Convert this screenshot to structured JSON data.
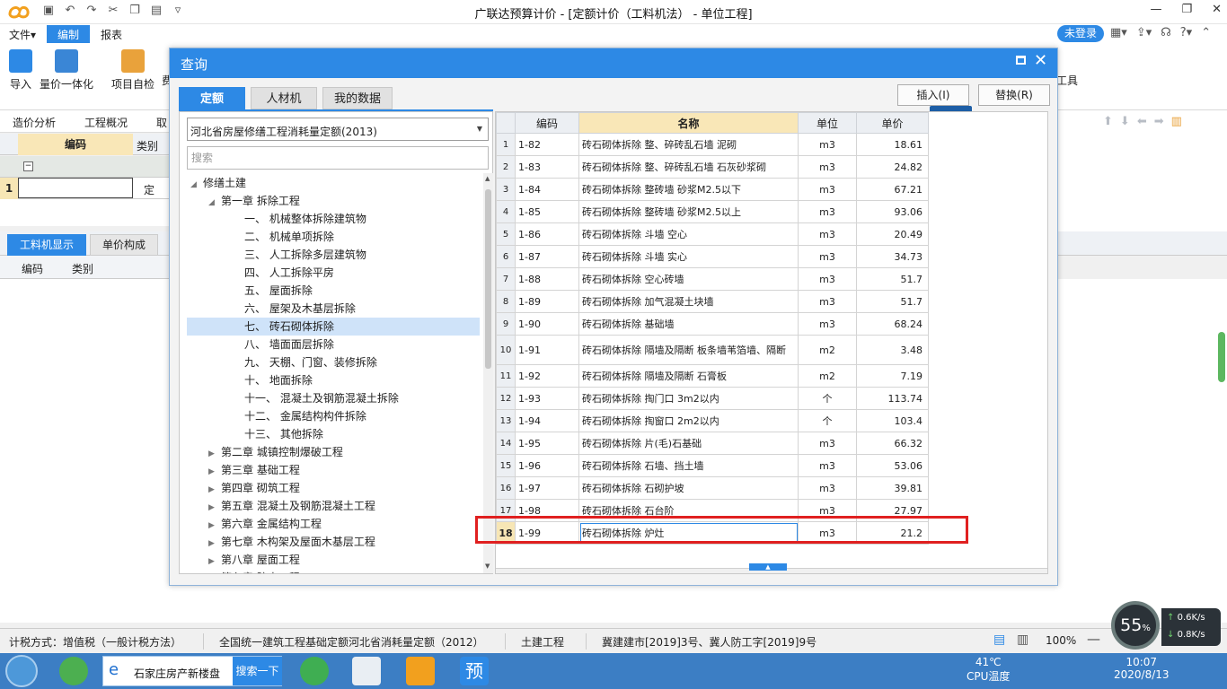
{
  "app": {
    "window_title": "广联达预算计价 - [定额计价（工料机法） - 单位工程]"
  },
  "menu": {
    "file": "文件▾",
    "edit": "编制",
    "report": "报表",
    "login": "未登录"
  },
  "ribbon": {
    "import": "导入",
    "quantity": "量价一体化",
    "check": "项目自检",
    "more": "费",
    "tools": "工具"
  },
  "workspace": {
    "tab_cost_analysis": "造价分析",
    "tab_overview": "工程概况",
    "tab_partial": "取",
    "col_code": "编码",
    "col_type": "类别",
    "row1_num": "1",
    "row1_type": "定",
    "lower_tab_labor": "工料机显示",
    "lower_tab_price": "单价构成",
    "lower_col_code": "编码",
    "lower_col_type": "类别"
  },
  "dialog": {
    "title": "查询",
    "tabs": [
      "定额",
      "人材机",
      "我的数据"
    ],
    "insert_button": "插入(I)",
    "replace_button": "替换(R)",
    "library_selected": "河北省房屋修缮工程消耗量定额(2013)",
    "search_placeholder": "搜索",
    "tree": [
      {
        "label": "修缮土建",
        "level": 0,
        "expander": "▲"
      },
      {
        "label": "第一章  拆除工程",
        "level": 1,
        "expander": "◢"
      },
      {
        "label": "一、  机械整体拆除建筑物",
        "level": 2
      },
      {
        "label": "二、  机械单项拆除",
        "level": 2
      },
      {
        "label": "三、  人工拆除多层建筑物",
        "level": 2
      },
      {
        "label": "四、  人工拆除平房",
        "level": 2
      },
      {
        "label": "五、  屋面拆除",
        "level": 2
      },
      {
        "label": "六、  屋架及木基层拆除",
        "level": 2
      },
      {
        "label": "七、  砖石砌体拆除",
        "level": 2,
        "selected": true
      },
      {
        "label": "八、  墙面面层拆除",
        "level": 2
      },
      {
        "label": "九、  天棚、门窗、装修拆除",
        "level": 2
      },
      {
        "label": "十、  地面拆除",
        "level": 2
      },
      {
        "label": "十一、  混凝土及钢筋混凝土拆除",
        "level": 2
      },
      {
        "label": "十二、  金属结构构件拆除",
        "level": 2
      },
      {
        "label": "十三、  其他拆除",
        "level": 2
      },
      {
        "label": "第二章  城镇控制爆破工程",
        "level": 1,
        "expander": "▶"
      },
      {
        "label": "第三章  基础工程",
        "level": 1,
        "expander": "▶"
      },
      {
        "label": "第四章  砌筑工程",
        "level": 1,
        "expander": "▶"
      },
      {
        "label": "第五章  混凝土及钢筋混凝土工程",
        "level": 1,
        "expander": "▶"
      },
      {
        "label": "第六章  金属结构工程",
        "level": 1,
        "expander": "▶"
      },
      {
        "label": "第七章  木构架及屋面木基层工程",
        "level": 1,
        "expander": "▶"
      },
      {
        "label": "第八章  屋面工程",
        "level": 1,
        "expander": "▶"
      },
      {
        "label": "第九章  防水工程",
        "level": 1,
        "expander": "▶"
      }
    ],
    "table": {
      "headers": [
        "编码",
        "名称",
        "单位",
        "单价"
      ],
      "rows": [
        {
          "n": "1",
          "code": "1-82",
          "name": "砖石砌体拆除 整、碎砖乱石墙 泥砌",
          "unit": "m3",
          "price": "18.61"
        },
        {
          "n": "2",
          "code": "1-83",
          "name": "砖石砌体拆除 整、碎砖乱石墙 石灰砂浆砌",
          "unit": "m3",
          "price": "24.82"
        },
        {
          "n": "3",
          "code": "1-84",
          "name": "砖石砌体拆除 整砖墙 砂浆M2.5以下",
          "unit": "m3",
          "price": "67.21"
        },
        {
          "n": "4",
          "code": "1-85",
          "name": "砖石砌体拆除 整砖墙 砂浆M2.5以上",
          "unit": "m3",
          "price": "93.06"
        },
        {
          "n": "5",
          "code": "1-86",
          "name": "砖石砌体拆除 斗墙 空心",
          "unit": "m3",
          "price": "20.49"
        },
        {
          "n": "6",
          "code": "1-87",
          "name": "砖石砌体拆除 斗墙 实心",
          "unit": "m3",
          "price": "34.73"
        },
        {
          "n": "7",
          "code": "1-88",
          "name": "砖石砌体拆除 空心砖墙",
          "unit": "m3",
          "price": "51.7"
        },
        {
          "n": "8",
          "code": "1-89",
          "name": "砖石砌体拆除 加气混凝土块墙",
          "unit": "m3",
          "price": "51.7"
        },
        {
          "n": "9",
          "code": "1-90",
          "name": "砖石砌体拆除 基础墙",
          "unit": "m3",
          "price": "68.24"
        },
        {
          "n": "10",
          "code": "1-91",
          "name": "砖石砌体拆除 隔墙及隔断 板条墙苇箔墙、隔断",
          "unit": "m2",
          "price": "3.48",
          "tall": true
        },
        {
          "n": "11",
          "code": "1-92",
          "name": "砖石砌体拆除 隔墙及隔断 石膏板",
          "unit": "m2",
          "price": "7.19"
        },
        {
          "n": "12",
          "code": "1-93",
          "name": "砖石砌体拆除 掏门口 3m2以内",
          "unit": "个",
          "price": "113.74"
        },
        {
          "n": "13",
          "code": "1-94",
          "name": "砖石砌体拆除 掏窗口 2m2以内",
          "unit": "个",
          "price": "103.4"
        },
        {
          "n": "14",
          "code": "1-95",
          "name": "砖石砌体拆除 片(毛)石基础",
          "unit": "m3",
          "price": "66.32"
        },
        {
          "n": "15",
          "code": "1-96",
          "name": "砖石砌体拆除 石墙、挡土墙",
          "unit": "m3",
          "price": "53.06"
        },
        {
          "n": "16",
          "code": "1-97",
          "name": "砖石砌体拆除 石砌护坡",
          "unit": "m3",
          "price": "39.81"
        },
        {
          "n": "17",
          "code": "1-98",
          "name": "砖石砌体拆除 石台阶",
          "unit": "m3",
          "price": "27.97"
        },
        {
          "n": "18",
          "code": "1-99",
          "name": "砖石砌体拆除 炉灶",
          "unit": "m3",
          "price": "21.2",
          "selected": true
        }
      ]
    }
  },
  "statusbar": {
    "tax_mode": "计税方式：增值税（一般计税方法）",
    "standard": "全国统一建筑工程基础定额河北省消耗量定额（2012）",
    "discipline": "土建工程",
    "document": "冀建建市[2019]3号、冀人防工字[2019]9号",
    "zoom": "100%"
  },
  "perf": {
    "percent": "55",
    "percent_sign": "%",
    "up_rate": "0.6K/s",
    "down_rate": "0.8K/s"
  },
  "taskbar": {
    "browser_tab": "石家庄房产新楼盘",
    "search_button": "搜索一下",
    "temp": "41℃",
    "temp_label": "CPU温度",
    "time": "10:07",
    "date": "2020/8/13"
  },
  "colors": {
    "accent": "#2d89e5",
    "highlight_red": "#e02020",
    "header_gold": "#f9e7b7"
  }
}
